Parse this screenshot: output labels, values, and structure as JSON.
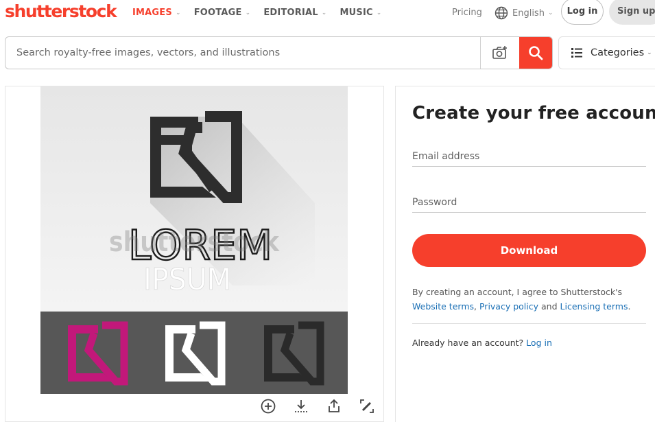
{
  "header": {
    "logo_text": "shutterstock",
    "nav": [
      {
        "label": "IMAGES",
        "active": true
      },
      {
        "label": "FOOTAGE",
        "active": false
      },
      {
        "label": "EDITORIAL",
        "active": false
      },
      {
        "label": "MUSIC",
        "active": false
      }
    ],
    "pricing": "Pricing",
    "language": "English",
    "login": "Log in",
    "signup": "Sign up"
  },
  "search": {
    "placeholder": "Search royalty-free images, vectors, and illustrations",
    "categories": "Categories"
  },
  "preview": {
    "logo_text_line1": "LOREM",
    "logo_text_line2": "IPSUM",
    "watermark": "shutterstock",
    "tile_colors": [
      "#c2187a",
      "#ffffff",
      "#2a2a2a"
    ]
  },
  "signup_panel": {
    "title": "Create your free account",
    "email_label": "Email address",
    "password_label": "Password",
    "download_button": "Download",
    "terms_prefix": "By creating an account, I agree to Shutterstock's",
    "terms_link1": "Website terms",
    "terms_sep1": ",",
    "terms_link2": "Privacy policy",
    "terms_and": "and",
    "terms_link3": "Licensing terms",
    "terms_end": ".",
    "already_text": "Already have an account?",
    "already_link": "Log in"
  },
  "colors": {
    "brand": "#f63f2c",
    "link": "#1a6fb5"
  }
}
